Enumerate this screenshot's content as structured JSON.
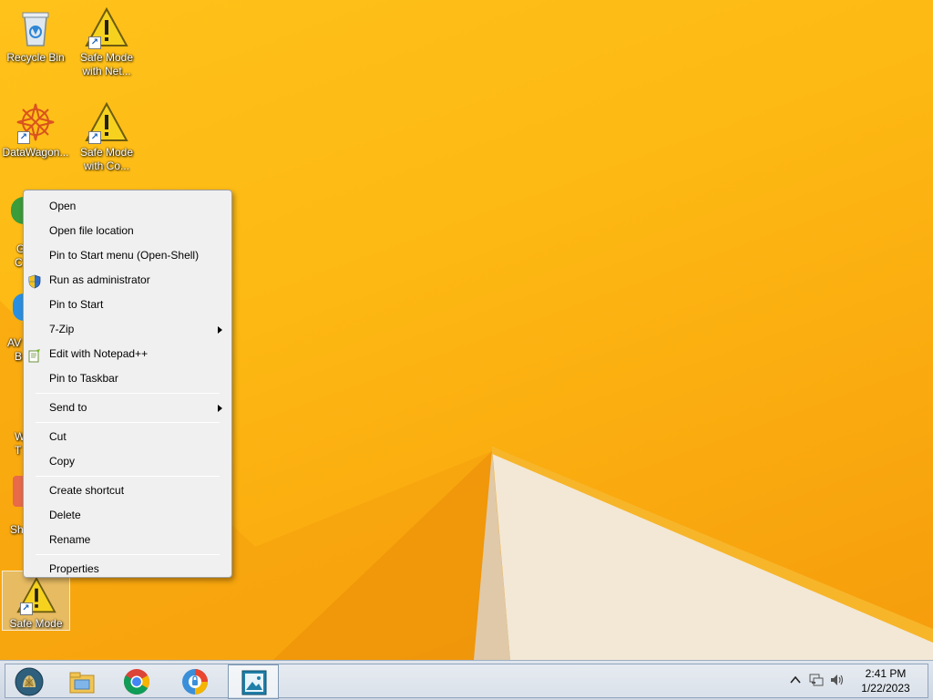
{
  "desktop": {
    "icons": [
      {
        "label": "Recycle Bin"
      },
      {
        "label": "Safe Mode with Net..."
      },
      {
        "label": "DataWagon..."
      },
      {
        "label": "Safe Mode with Co..."
      },
      {
        "label": "Safe Mode"
      }
    ],
    "partial_labels": [
      "G",
      "C",
      "AV",
      "B",
      "W",
      "T",
      "Sh"
    ]
  },
  "context_menu": {
    "items": [
      {
        "label": "Open"
      },
      {
        "label": "Open file location"
      },
      {
        "label": "Pin to Start menu (Open-Shell)"
      },
      {
        "label": "Run as administrator",
        "icon": "uac-shield-icon"
      },
      {
        "label": "Pin to Start"
      },
      {
        "label": "7-Zip",
        "submenu": true
      },
      {
        "label": "Edit with Notepad++",
        "icon": "notepad-plus-plus-icon"
      },
      {
        "label": "Pin to Taskbar"
      },
      {
        "label": "Send to",
        "submenu": true
      },
      {
        "label": "Cut"
      },
      {
        "label": "Copy"
      },
      {
        "label": "Create shortcut"
      },
      {
        "label": "Delete"
      },
      {
        "label": "Rename"
      },
      {
        "label": "Properties"
      }
    ]
  },
  "taskbar": {
    "buttons": [
      {
        "name": "start-orb-icon"
      },
      {
        "name": "file-explorer-icon"
      },
      {
        "name": "chrome-icon"
      },
      {
        "name": "avg-browser-icon"
      },
      {
        "name": "image-app-icon"
      }
    ],
    "tray": {
      "icons": [
        "chevron-up-icon",
        "network-icon",
        "speaker-icon"
      ],
      "time": "2:41 PM",
      "date": "1/22/2023"
    }
  },
  "colors": {
    "wallpaper": "#fdb813",
    "menu_bg": "#f0f0f0",
    "taskbar_bg": "#d6dde8"
  }
}
